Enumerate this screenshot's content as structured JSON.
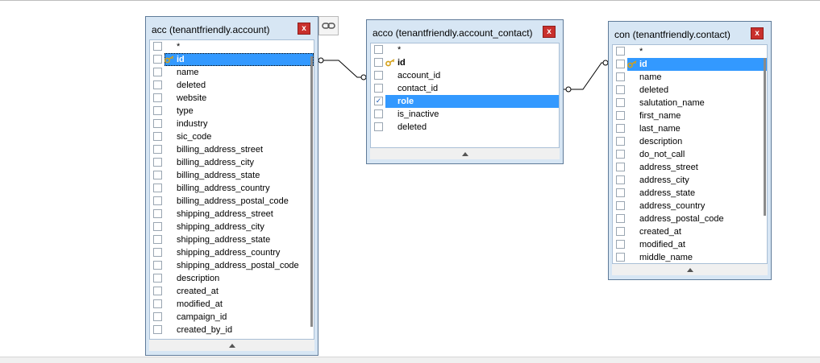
{
  "tables": [
    {
      "id": "acc",
      "title": "acc (tenantfriendly.account)",
      "close_label": "x",
      "fields": [
        {
          "name": "*"
        },
        {
          "name": "id",
          "pk": true,
          "selected": true,
          "focus": true
        },
        {
          "name": "name"
        },
        {
          "name": "deleted"
        },
        {
          "name": "website"
        },
        {
          "name": "type"
        },
        {
          "name": "industry"
        },
        {
          "name": "sic_code"
        },
        {
          "name": "billing_address_street"
        },
        {
          "name": "billing_address_city"
        },
        {
          "name": "billing_address_state"
        },
        {
          "name": "billing_address_country"
        },
        {
          "name": "billing_address_postal_code"
        },
        {
          "name": "shipping_address_street"
        },
        {
          "name": "shipping_address_city"
        },
        {
          "name": "shipping_address_state"
        },
        {
          "name": "shipping_address_country"
        },
        {
          "name": "shipping_address_postal_code"
        },
        {
          "name": "description"
        },
        {
          "name": "created_at"
        },
        {
          "name": "modified_at"
        },
        {
          "name": "campaign_id"
        },
        {
          "name": "created_by_id"
        }
      ]
    },
    {
      "id": "acco",
      "title": "acco (tenantfriendly.account_contact)",
      "close_label": "x",
      "fields": [
        {
          "name": "*"
        },
        {
          "name": "id",
          "pk": true
        },
        {
          "name": "account_id"
        },
        {
          "name": "contact_id"
        },
        {
          "name": "role",
          "checked": true,
          "selected": true
        },
        {
          "name": "is_inactive"
        },
        {
          "name": "deleted"
        }
      ]
    },
    {
      "id": "con",
      "title": "con (tenantfriendly.contact)",
      "close_label": "x",
      "fields": [
        {
          "name": "*"
        },
        {
          "name": "id",
          "pk": true,
          "selected": true
        },
        {
          "name": "name"
        },
        {
          "name": "deleted"
        },
        {
          "name": "salutation_name"
        },
        {
          "name": "first_name"
        },
        {
          "name": "last_name"
        },
        {
          "name": "description"
        },
        {
          "name": "do_not_call"
        },
        {
          "name": "address_street"
        },
        {
          "name": "address_city"
        },
        {
          "name": "address_state"
        },
        {
          "name": "address_country"
        },
        {
          "name": "address_postal_code"
        },
        {
          "name": "created_at"
        },
        {
          "name": "modified_at"
        },
        {
          "name": "middle_name"
        }
      ]
    }
  ],
  "toolbar": {
    "link_icon": "link-icon"
  },
  "colors": {
    "selection": "#3399ff",
    "table_bg": "#d7e6f4",
    "close": "#c9302c"
  }
}
